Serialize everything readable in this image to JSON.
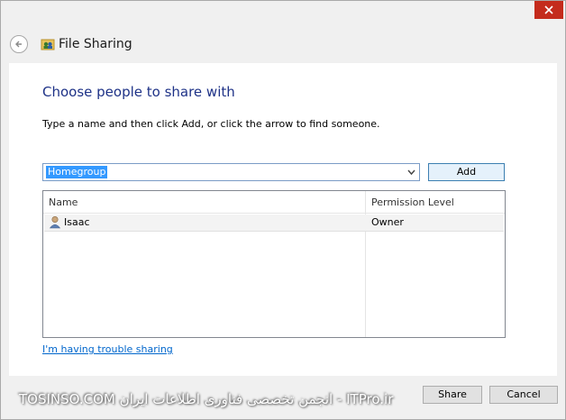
{
  "window": {
    "title": "File Sharing",
    "close_icon": "close-icon",
    "back_icon": "back-arrow-icon",
    "app_icon": "file-sharing-icon",
    "close_color": "#c42b1c"
  },
  "main": {
    "heading": "Choose people to share with",
    "instructions": "Type a name and then click Add, or click the arrow to find someone.",
    "combo": {
      "value": "Homegroup"
    },
    "add_label": "Add",
    "list": {
      "columns": [
        "Name",
        "Permission Level"
      ],
      "rows": [
        {
          "name": "Isaac",
          "permission": "Owner",
          "icon": "user-icon"
        }
      ]
    },
    "trouble_link": "I'm having trouble sharing"
  },
  "footer": {
    "watermark": "TOSINSO.COM  انجمن تخصصی فناوری اطلاعات ایران - ITPro.ir",
    "share_label": "Share",
    "cancel_label": "Cancel"
  }
}
